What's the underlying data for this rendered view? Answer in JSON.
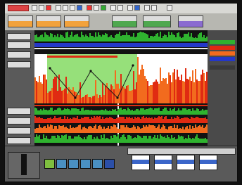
{
  "window": {
    "title": ""
  },
  "status_panels": [
    {
      "label": "",
      "value": "",
      "style": "orange"
    },
    {
      "label": "",
      "value": "",
      "style": "orange"
    },
    {
      "label": "",
      "value": "",
      "style": "orange"
    },
    {
      "label": "",
      "value": "",
      "style": "green"
    },
    {
      "label": "",
      "value": "",
      "style": "green"
    },
    {
      "label": "",
      "value": "",
      "style": "purple"
    }
  ],
  "colors": {
    "signal_red": "#e02b12",
    "signal_orange": "#f26b1e",
    "trace_green": "#2fb32f",
    "highlight_green": "#96e07a",
    "trace_blue": "#2437c9",
    "background_black": "#121212",
    "panel_gray": "#5a5a5a"
  },
  "icons": [
    "play-icon",
    "stop-icon",
    "rewind-icon",
    "forward-icon",
    "record-icon",
    "settings-icon"
  ],
  "video_thumbnails": 4
}
